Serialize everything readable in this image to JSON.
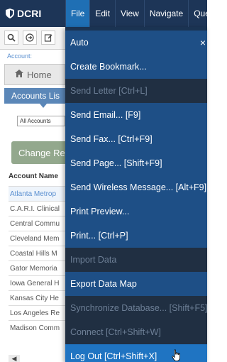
{
  "app": {
    "logo_text": "DCRI"
  },
  "menubar": [
    {
      "label": "File",
      "active": true
    },
    {
      "label": "Edit"
    },
    {
      "label": "View"
    },
    {
      "label": "Navigate"
    },
    {
      "label": "Quer"
    }
  ],
  "toolbar": {
    "icons": [
      "search-icon",
      "forward-icon",
      "edit-icon"
    ]
  },
  "account_label": "Account:",
  "home_tab": "Home",
  "accounts_list_title": "Accounts Lis",
  "filter_select_value": "All Accounts",
  "change_button_label": "Change Re",
  "table": {
    "column_header": "Account Name",
    "rows": [
      "Atlanta Metrop",
      "C.A.R.I. Clinical",
      "Central Commu",
      "Cleveland Mem",
      "Coastal Hills M",
      "Gator Memoria",
      "Iowa General H",
      "Kansas City He",
      "Los Angeles Re",
      "Madison Comm"
    ]
  },
  "file_menu": {
    "items": [
      {
        "label": "Auto",
        "enabled": true
      },
      {
        "label": "Create Bookmark...",
        "enabled": true
      },
      {
        "label": "Send Letter [Ctrl+L]",
        "enabled": false
      },
      {
        "label": "Send Email... [F9]",
        "enabled": true
      },
      {
        "label": "Send Fax... [Ctrl+F9]",
        "enabled": true
      },
      {
        "label": "Send Page... [Shift+F9]",
        "enabled": true
      },
      {
        "label": "Send Wireless Message... [Alt+F9]",
        "enabled": true
      },
      {
        "label": "Print Preview...",
        "enabled": true
      },
      {
        "label": "Print... [Ctrl+P]",
        "enabled": true
      },
      {
        "label": "Import Data",
        "enabled": false
      },
      {
        "label": "Export Data Map",
        "enabled": true
      },
      {
        "label": "Synchronize Database... [Shift+F5]",
        "enabled": false
      },
      {
        "label": "Connect [Ctrl+Shift+W]",
        "enabled": false
      },
      {
        "label": "Log Out [Ctrl+Shift+X]",
        "enabled": true,
        "hovered": true
      }
    ],
    "close_glyph": "×"
  },
  "colors": {
    "topbar": "#1d3557",
    "menu_active": "#1f6fb4",
    "menu_item_enabled": "#1e4f86",
    "menu_item_disabled": "#202f42",
    "menu_item_hover": "#1f74c2",
    "change_button": "#93a88d"
  }
}
